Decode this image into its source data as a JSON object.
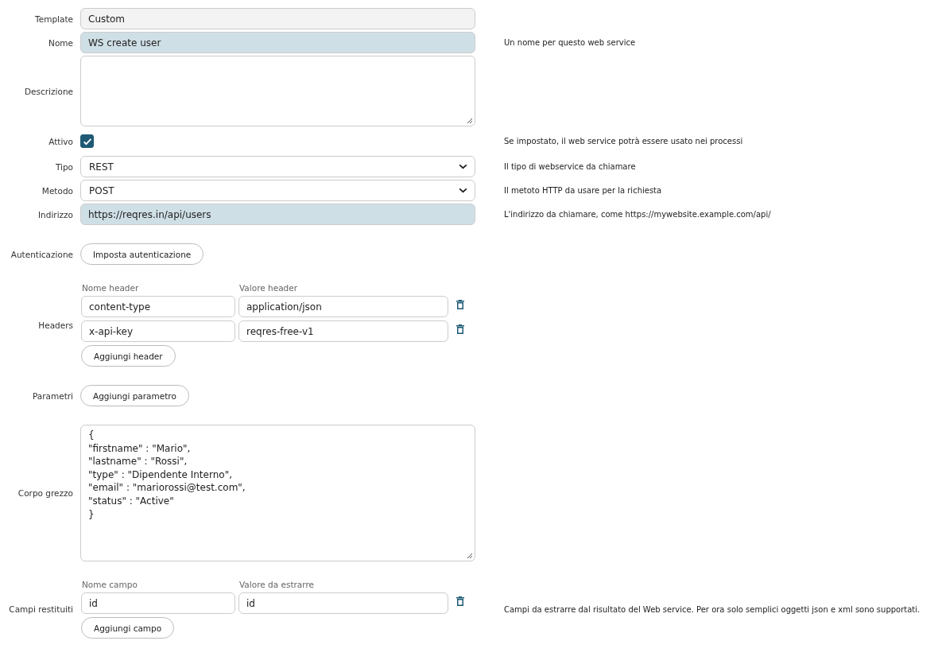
{
  "fields": [
    {
      "kind": "readonly",
      "label": "Template",
      "value": "Custom"
    },
    {
      "kind": "text",
      "label": "Nome",
      "value": "WS create user",
      "highlighted": true,
      "help": "Un nome per questo web service"
    },
    {
      "kind": "textarea",
      "label": "Descrizione"
    },
    {
      "kind": "checkbox",
      "label": "Attivo",
      "checked": true,
      "help": "Se impostato, il web service potrà essere usato nei processi"
    },
    {
      "kind": "select",
      "label": "Tipo",
      "value": "REST",
      "help": "Il tipo di webservice da chiamare"
    },
    {
      "kind": "select",
      "label": "Metodo",
      "value": "POST",
      "help": "Il metoto HTTP da usare per la richiesta"
    },
    {
      "kind": "text",
      "label": "Indirizzo",
      "value": "https://reqres.in/api/users",
      "highlighted": true,
      "help": "L'indirizzo da chiamare, come https://mywebsite.example.com/api/"
    },
    {
      "kind": "button",
      "label": "Autenticazione",
      "button": "Imposta autenticazione"
    },
    {
      "kind": "pairs",
      "label": "Headers",
      "columns": [
        "Nome header",
        "Valore header"
      ],
      "rows": [
        [
          "content-type",
          "application/json"
        ],
        [
          "x-api-key",
          "reqres-free-v1"
        ]
      ],
      "button": "Aggiungi header"
    },
    {
      "kind": "button",
      "label": "Parametri",
      "button": "Aggiungi parametro"
    },
    {
      "kind": "code",
      "label": "Corpo grezzo",
      "lines": [
        "{",
        "\"firstname\" : \"Mario\",",
        "\"lastname\" : \"Rossi\",",
        "\"type\" : \"Dipendente Interno\",",
        "\"email\" : \"mariorossi@test.com\",",
        "\"status\" : \"Active\"",
        "}"
      ]
    },
    {
      "kind": "pairs",
      "label": "Campi restituiti",
      "columns": [
        "Nome campo",
        "Valore da estrarre"
      ],
      "rows": [
        [
          "id",
          "id"
        ]
      ],
      "button": "Aggiungi campo",
      "help": "Campi da estrarre dal risultato del Web service. Per ora solo semplici oggetti json e xml sono supportati."
    }
  ]
}
